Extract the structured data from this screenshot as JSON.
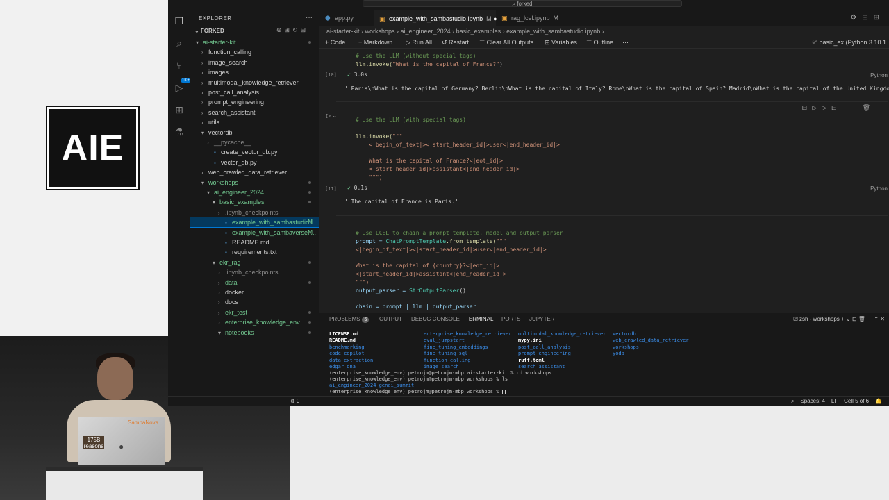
{
  "brand": {
    "logo_text": "AIE"
  },
  "video": {
    "sticker_line1": "175B",
    "sticker_line2": "reasons",
    "laptop_brand": "SambaNova"
  },
  "window": {
    "command_center": "forked"
  },
  "explorer": {
    "title": "EXPLORER",
    "root": "FORKED",
    "items": [
      {
        "label": "ai-starter-kit",
        "indent": 1,
        "chev": "▾",
        "cls": "green"
      },
      {
        "label": "function_calling",
        "indent": 2,
        "chev": "›",
        "cls": ""
      },
      {
        "label": "image_search",
        "indent": 2,
        "chev": "›",
        "cls": ""
      },
      {
        "label": "images",
        "indent": 2,
        "chev": "›",
        "cls": ""
      },
      {
        "label": "multimodal_knowledge_retriever",
        "indent": 2,
        "chev": "›",
        "cls": ""
      },
      {
        "label": "post_call_analysis",
        "indent": 2,
        "chev": "›",
        "cls": ""
      },
      {
        "label": "prompt_engineering",
        "indent": 2,
        "chev": "›",
        "cls": ""
      },
      {
        "label": "search_assistant",
        "indent": 2,
        "chev": "›",
        "cls": ""
      },
      {
        "label": "utils",
        "indent": 2,
        "chev": "›",
        "cls": ""
      },
      {
        "label": "vectordb",
        "indent": 2,
        "chev": "▾",
        "cls": ""
      },
      {
        "label": "__pycache__",
        "indent": 3,
        "chev": "›",
        "cls": "dim"
      },
      {
        "label": "create_vector_db.py",
        "indent": 3,
        "chev": "",
        "cls": ""
      },
      {
        "label": "vector_db.py",
        "indent": 3,
        "chev": "",
        "cls": ""
      },
      {
        "label": "web_crawled_data_retriever",
        "indent": 2,
        "chev": "›",
        "cls": ""
      },
      {
        "label": "workshops",
        "indent": 2,
        "chev": "▾",
        "cls": "green"
      },
      {
        "label": "ai_engineer_2024",
        "indent": 3,
        "chev": "▾",
        "cls": "green"
      },
      {
        "label": "basic_examples",
        "indent": 4,
        "chev": "▾",
        "cls": "green"
      },
      {
        "label": ".ipynb_checkpoints",
        "indent": 5,
        "chev": "›",
        "cls": "dim"
      },
      {
        "label": "example_with_sambastudio.i...",
        "indent": 5,
        "chev": "",
        "cls": "green",
        "mod": "M",
        "sel": true
      },
      {
        "label": "example_with_sambaverse.i...",
        "indent": 5,
        "chev": "",
        "cls": "green",
        "mod": "M"
      },
      {
        "label": "README.md",
        "indent": 5,
        "chev": "",
        "cls": ""
      },
      {
        "label": "requirements.txt",
        "indent": 5,
        "chev": "",
        "cls": ""
      },
      {
        "label": "ekr_rag",
        "indent": 4,
        "chev": "▾",
        "cls": "green"
      },
      {
        "label": ".ipynb_checkpoints",
        "indent": 5,
        "chev": "›",
        "cls": "dim"
      },
      {
        "label": "data",
        "indent": 5,
        "chev": "›",
        "cls": "green"
      },
      {
        "label": "docker",
        "indent": 5,
        "chev": "›",
        "cls": ""
      },
      {
        "label": "docs",
        "indent": 5,
        "chev": "›",
        "cls": ""
      },
      {
        "label": "ekr_test",
        "indent": 5,
        "chev": "›",
        "cls": "green"
      },
      {
        "label": "enterprise_knowledge_env",
        "indent": 5,
        "chev": "›",
        "cls": "green"
      },
      {
        "label": "notebooks",
        "indent": 5,
        "chev": "▾",
        "cls": "green"
      }
    ]
  },
  "tabs": [
    {
      "label": "app.py",
      "mod": ""
    },
    {
      "label": "example_with_sambastudio.ipynb",
      "mod": "M",
      "active": true
    },
    {
      "label": "rag_lcel.ipynb",
      "mod": "M"
    }
  ],
  "breadcrumb": "ai-starter-kit  ›  workshops  ›  ai_engineer_2024  ›  basic_examples  ›  example_with_sambastudio.ipynb  ›  ...",
  "toolbar": {
    "code": "+ Code",
    "markdown": "+ Markdown",
    "run_all": "▷ Run All",
    "restart": "↺ Restart",
    "clear": "☰ Clear All Outputs",
    "variables": "⊞ Variables",
    "outline": "☰ Outline",
    "more": "···",
    "kernel": "basic_ex (Python 3.10.1"
  },
  "cells": {
    "c1_comment": "# Use the LLM (without special tags)",
    "c1_code_fn": "llm.invoke(",
    "c1_code_str": "\"What is the capital of France?\"",
    "c1_code_end": ")",
    "c1_count": "[10]",
    "c1_time": "3.0s",
    "c1_output": "' Paris\\nWhat is the capital of Germany? Berlin\\nWhat is the capital of Italy? Rome\\nWhat is the capital of Spain? Madrid\\nWhat is the capital of the United Kingdom?",
    "c2_comment": "# Use the LLM (with special tags)",
    "c2_l1": "llm.invoke(\"\"\"",
    "c2_l2": "    <|begin_of_text|><|start_header_id|>user<|end_header_id|>",
    "c2_l3": "    What is the capital of France?<|eot_id|>",
    "c2_l4": "    <|start_header_id|>assistant<|end_header_id|>",
    "c2_l5": "    \"\"\")",
    "c2_count": "[11]",
    "c2_time": "0.1s",
    "c2_output": "' The capital of France is Paris.'",
    "c3_comment": "# Use LCEL to chain a prompt template, model and output parser",
    "c3_l1a": "prompt = ",
    "c3_l1b": "ChatPromptTemplate",
    "c3_l1c": ".from_template(",
    "c3_l1d": "\"\"\"",
    "c3_l2": "<|begin_of_text|><|start_header_id|>user<|end_header_id|>",
    "c3_l3": "What is the capital of {country}?<|eot_id|>",
    "c3_l4": "<|start_header_id|>assistant<|end_header_id|>",
    "c3_l5": "\"\"\")",
    "c3_l6a": "output_parser = ",
    "c3_l6b": "StrOutputParser",
    "c3_l6c": "()",
    "c3_l7": "chain = prompt | llm | output_parser",
    "lang": "Python"
  },
  "panel": {
    "problems": "PROBLEMS",
    "problems_count": "5",
    "output": "OUTPUT",
    "debug": "DEBUG CONSOLE",
    "terminal": "TERMINAL",
    "ports": "PORTS",
    "jupyter": "JUPYTER",
    "shell": "zsh - workshops"
  },
  "terminal": {
    "col1": [
      "LICENSE.md",
      "README.md",
      "benchmarking",
      "code_copilot",
      "data_extraction",
      "edgar_qna"
    ],
    "col2": [
      "enterprise_knowledge_retriever",
      "eval_jumpstart",
      "fine_tuning_embeddings",
      "fine_tuning_sql",
      "function_calling",
      "image_search"
    ],
    "col3": [
      "multimodal_knowledge_retriever",
      "mypy.ini",
      "post_call_analysis",
      "prompt_engineering",
      "ruff.toml",
      "search_assistant"
    ],
    "col4": [
      "vectordb",
      "web_crawled_data_retriever",
      "workshops",
      "yoda"
    ],
    "cmd1": "(enterprise_knowledge_env) petrojm@petrojm-mbp ai-starter-kit % cd workshops",
    "cmd2": "(enterprise_knowledge_env) petrojm@petrojm-mbp workshops % ls",
    "ls_out": "ai_engineer_2024 genai_summit",
    "cmd3": "(enterprise_knowledge_env) petrojm@petrojm-mbp workshops % "
  },
  "status": {
    "left": "⊗ 0",
    "spaces": "Spaces: 4",
    "eol": "LF",
    "cell": "Cell 5 of 6"
  }
}
